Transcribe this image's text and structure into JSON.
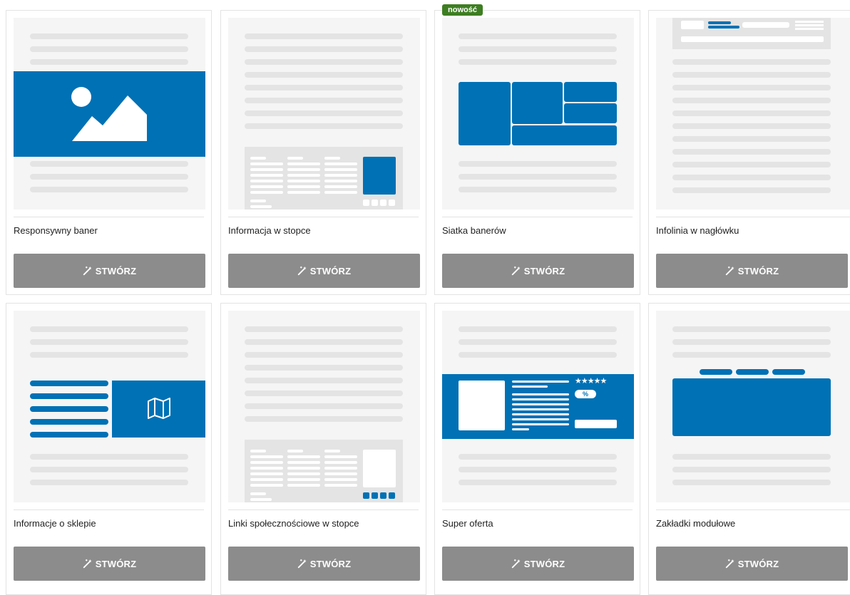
{
  "badge": {
    "label": "nowość"
  },
  "cards": [
    {
      "title": "Responsywny baner",
      "button": "STWÓRZ"
    },
    {
      "title": "Informacja w stopce",
      "button": "STWÓRZ"
    },
    {
      "title": "Siatka banerów",
      "button": "STWÓRZ"
    },
    {
      "title": "Infolinia w nagłówku",
      "button": "STWÓRZ"
    },
    {
      "title": "Informacje o sklepie",
      "button": "STWÓRZ"
    },
    {
      "title": "Linki społecznościowe w stopce",
      "button": "STWÓRZ"
    },
    {
      "title": "Super oferta",
      "button": "STWÓRZ"
    },
    {
      "title": "Zakładki modułowe",
      "button": "STWÓRZ"
    }
  ],
  "icons": {
    "button": "magic-wand-icon",
    "preview_image": "image-icon",
    "preview_map": "map-icon",
    "stars": "★★★★★",
    "percent": "%"
  },
  "colors": {
    "accent": "#0071b5",
    "button": "#8c8c8c",
    "badge": "#3e7e22",
    "placeholder_line": "#e4e4e4",
    "preview_bg": "#f5f5f5"
  }
}
